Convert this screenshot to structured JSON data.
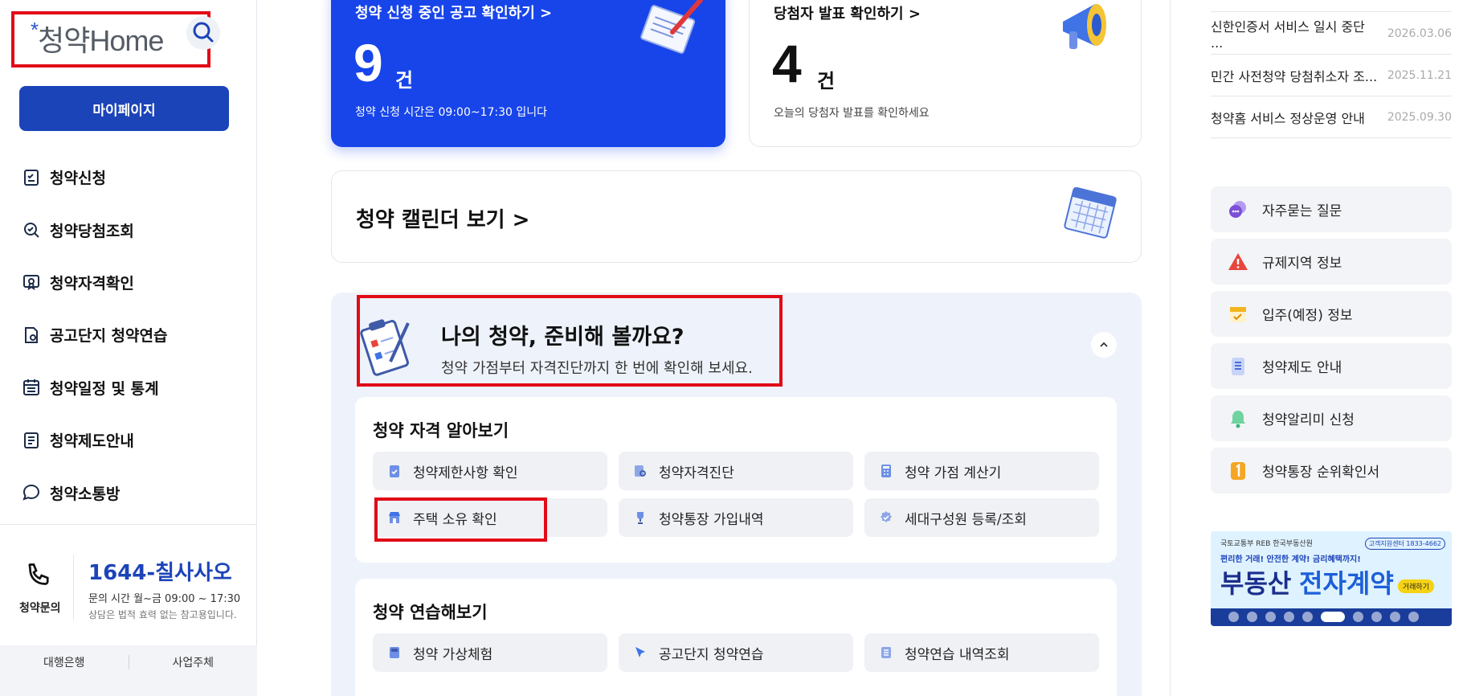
{
  "sidebar": {
    "logo_text": "청약Home",
    "mypage_label": "마이페이지",
    "nav": [
      {
        "label": "청약신청",
        "icon": "checklist-icon"
      },
      {
        "label": "청약당첨조회",
        "icon": "search-check-icon"
      },
      {
        "label": "청약자격확인",
        "icon": "certificate-icon"
      },
      {
        "label": "공고단지 청약연습",
        "icon": "document-gear-icon"
      },
      {
        "label": "청약일정 및 통계",
        "icon": "calendar-list-icon"
      },
      {
        "label": "청약제도안내",
        "icon": "document-list-icon"
      },
      {
        "label": "청약소통방",
        "icon": "chat-bubble-icon"
      }
    ],
    "contact": {
      "label": "청약문의",
      "number": "1644-칠사사오",
      "hours": "문의 시간 월~금 09:00 ~ 17:30",
      "note": "상담은 법적 효력 없는 참고용입니다."
    },
    "bottom_tabs": [
      "대행은행",
      "사업주체"
    ]
  },
  "main": {
    "card_ongoing": {
      "title": "청약 신청 중인 공고 확인하기 >",
      "count": "9",
      "unit": "건",
      "sub": "청약 신청 시간은 09:00~17:30 입니다"
    },
    "card_winner": {
      "title": "당첨자 발표 확인하기 >",
      "count": "4",
      "unit": "건",
      "sub": "오늘의 당첨자 발표를 확인하세요"
    },
    "calendar_label": "청약 캘린더 보기 >",
    "prep": {
      "title": "나의 청약, 준비해 볼까요?",
      "subtitle": "청약 가점부터 자격진단까지 한 번에 확인해 보세요."
    },
    "group_qualify": {
      "title": "청약 자격 알아보기",
      "buttons": [
        "청약제한사항 확인",
        "청약자격진단",
        "청약 가점 계산기",
        "주택 소유 확인",
        "청약통장 가입내역",
        "세대구성원 등록/조회"
      ]
    },
    "group_practice": {
      "title": "청약 연습해보기",
      "buttons": [
        "청약 가상체험",
        "공고단지 청약연습",
        "청약연습 내역조회"
      ]
    }
  },
  "right": {
    "notices": [
      {
        "title": "신한인증서 서비스 일시 중단 ...",
        "date": "2026.03.06"
      },
      {
        "title": "민간 사전청약 당첨취소자 조...",
        "date": "2025.11.21"
      },
      {
        "title": "청약홈 서비스 정상운영 안내",
        "date": "2025.09.30"
      }
    ],
    "quick_links": [
      {
        "label": "자주묻는 질문",
        "icon": "chat-bubbles-icon",
        "color": "#7b4fd6"
      },
      {
        "label": "규제지역 정보",
        "icon": "warning-icon",
        "color": "#e8453c"
      },
      {
        "label": "입주(예정) 정보",
        "icon": "calendar-check-icon",
        "color": "#f2b51e"
      },
      {
        "label": "청약제도 안내",
        "icon": "document-icon",
        "color": "#4a6be0"
      },
      {
        "label": "청약알리미 신청",
        "icon": "bell-icon",
        "color": "#35b87a"
      },
      {
        "label": "청약통장 순위확인서",
        "icon": "number-one-icon",
        "color": "#f5a623"
      }
    ],
    "banner": {
      "top_left": "국토교통부  REB 한국부동산원",
      "top_right": "고객지원센터 1833-4662",
      "sub": "편리한 거래! 안전한 계약! 금리혜택까지!",
      "main1": "부동산",
      "main2": "전자계약",
      "button": "거래하기",
      "slide_count": 10,
      "active_slide": 5
    }
  },
  "colors": {
    "primary": "#1c44b9",
    "card_blue": "#1845ea",
    "highlight": "#e10b17",
    "panel_bg": "#eef3fb"
  }
}
